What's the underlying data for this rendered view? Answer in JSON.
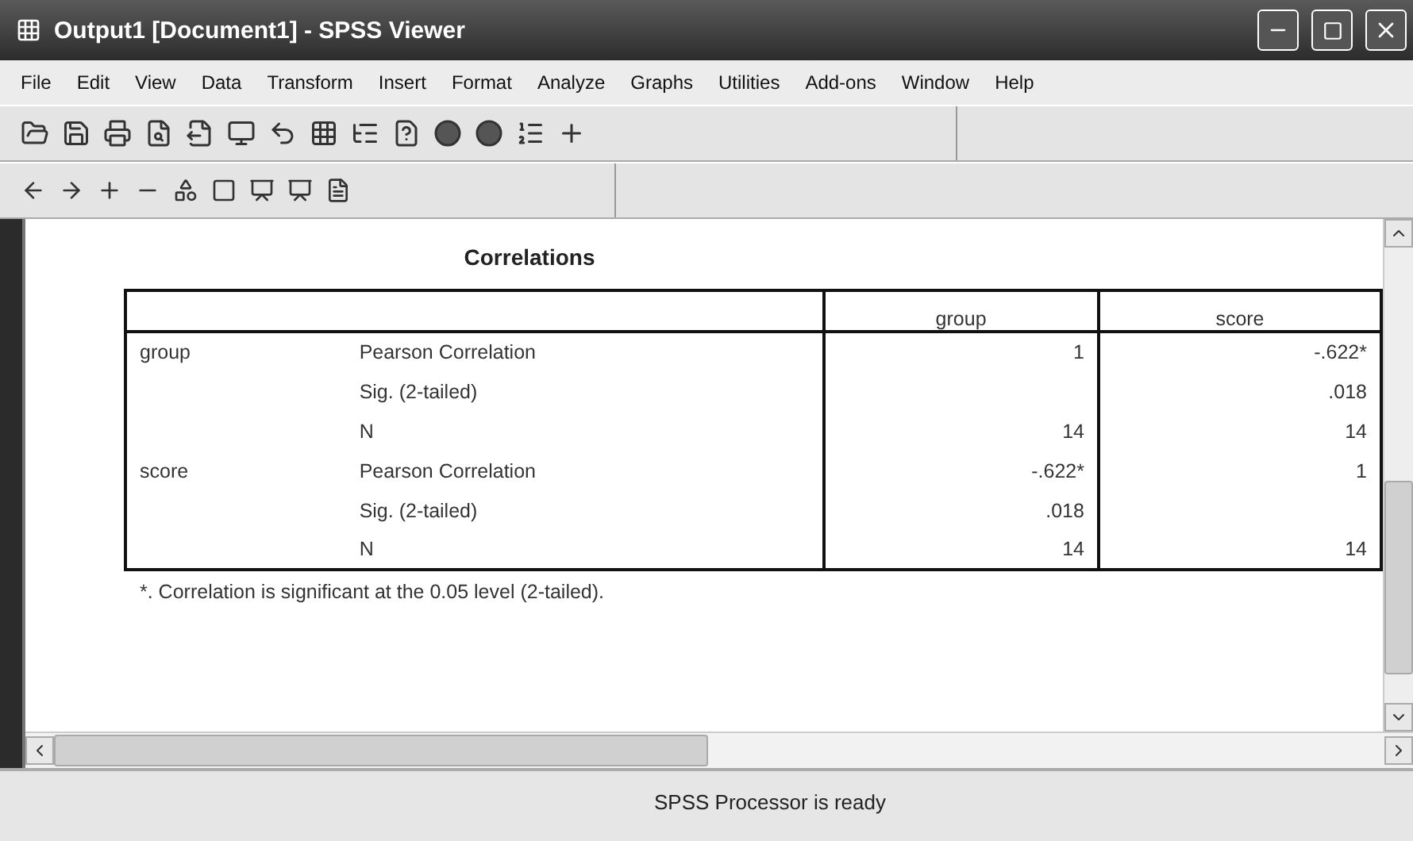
{
  "window": {
    "title": "Output1 [Document1] - SPSS Viewer"
  },
  "menu": [
    "File",
    "Edit",
    "View",
    "Data",
    "Transform",
    "Insert",
    "Format",
    "Analyze",
    "Graphs",
    "Utilities",
    "Add-ons",
    "Window",
    "Help"
  ],
  "output": {
    "title": "Correlations",
    "columns": [
      "group",
      "score"
    ],
    "rows": [
      {
        "variable": "group",
        "statistic": "Pearson Correlation",
        "group_value": "1",
        "score_value": "-.622*"
      },
      {
        "statistic": "Sig. (2-tailed)",
        "score_value": ".018"
      },
      {
        "statistic": "N",
        "group_value": "14",
        "score_value": "14"
      },
      {
        "variable": "score",
        "statistic": "Pearson Correlation",
        "group_value": "-.622*",
        "score_value": "1"
      },
      {
        "statistic": "Sig. (2-tailed)",
        "group_value": ".018"
      },
      {
        "statistic": "N",
        "group_value": "14",
        "score_value": "14"
      }
    ],
    "footnote": "*. Correlation is significant at the 0.05 level (2-tailed)."
  },
  "status_bar": "SPSS Processor is ready"
}
